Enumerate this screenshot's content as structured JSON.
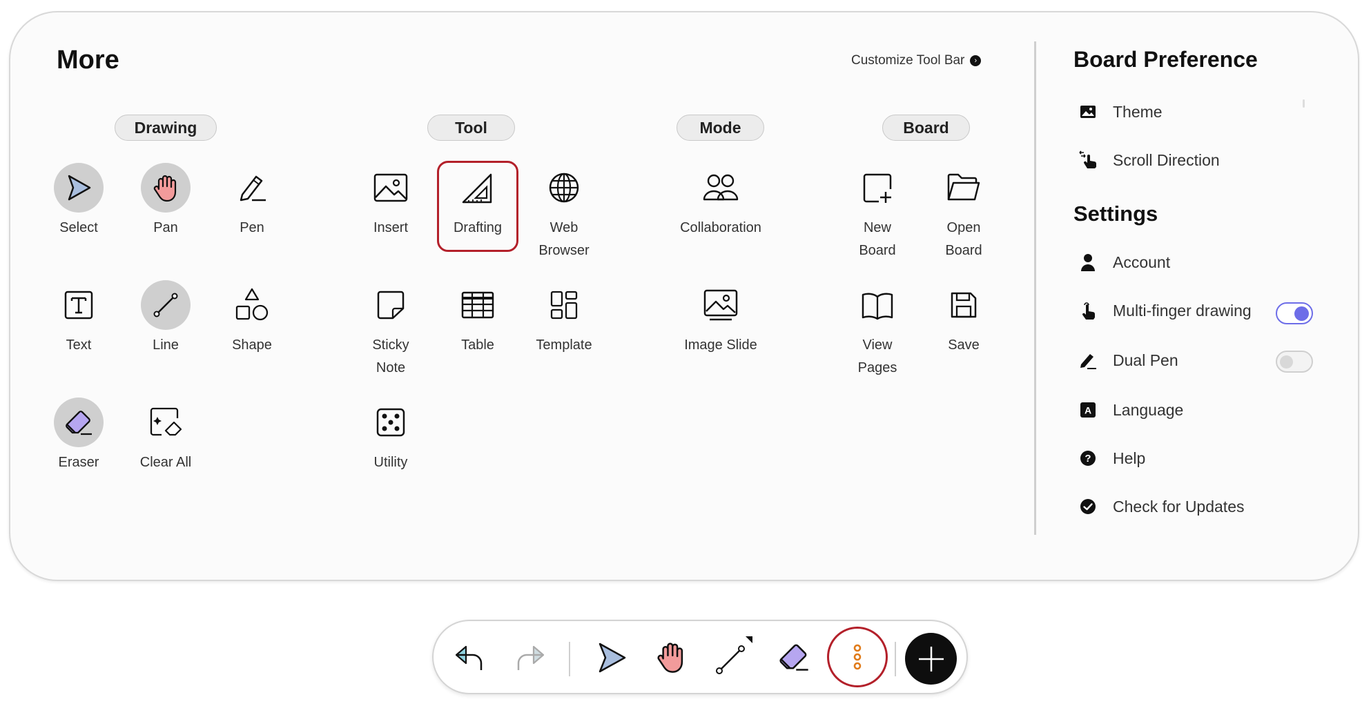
{
  "panel": {
    "title": "More",
    "customize_label": "Customize Tool Bar",
    "categories": {
      "drawing": "Drawing",
      "tool": "Tool",
      "mode": "Mode",
      "board": "Board"
    },
    "drawing_tools": [
      {
        "label": "Select",
        "icon": "select-arrow-icon",
        "selected": true
      },
      {
        "label": "Pan",
        "icon": "hand-icon",
        "selected": true
      },
      {
        "label": "Pen",
        "icon": "pen-icon",
        "selected": false
      },
      {
        "label": "Text",
        "icon": "text-icon",
        "selected": false
      },
      {
        "label": "Line",
        "icon": "line-icon",
        "selected": true
      },
      {
        "label": "Shape",
        "icon": "shape-icon",
        "selected": false
      },
      {
        "label": "Eraser",
        "icon": "eraser-icon",
        "selected": true
      },
      {
        "label": "Clear All",
        "icon": "clear-all-icon",
        "selected": false
      }
    ],
    "tool_tools": [
      {
        "label": "Insert",
        "icon": "image-icon"
      },
      {
        "label": "Drafting",
        "icon": "set-square-icon",
        "highlighted": true
      },
      {
        "label": "Web\nBrowser",
        "icon": "globe-icon"
      },
      {
        "label": "Sticky\nNote",
        "icon": "sticky-note-icon"
      },
      {
        "label": "Table",
        "icon": "table-icon"
      },
      {
        "label": "Template",
        "icon": "template-icon"
      },
      {
        "label": "Utility",
        "icon": "dice-icon"
      }
    ],
    "mode_tools": [
      {
        "label": "Collaboration",
        "icon": "people-icon"
      },
      {
        "label": "Image Slide",
        "icon": "image-slide-icon"
      }
    ],
    "board_tools": [
      {
        "label": "New\nBoard",
        "icon": "new-board-icon"
      },
      {
        "label": "Open\nBoard",
        "icon": "folder-icon"
      },
      {
        "label": "View\nPages",
        "icon": "book-icon"
      },
      {
        "label": "Save",
        "icon": "floppy-icon"
      }
    ]
  },
  "preferences": {
    "board_title": "Board Preference",
    "board_items": [
      {
        "label": "Theme",
        "icon": "image-icon"
      },
      {
        "label": "Scroll Direction",
        "icon": "scroll-hand-icon"
      }
    ],
    "settings_title": "Settings",
    "settings_items": [
      {
        "label": "Account",
        "icon": "person-icon"
      },
      {
        "label": "Multi-finger drawing",
        "icon": "finger-icon",
        "toggle": true
      },
      {
        "label": "Dual Pen",
        "icon": "dual-pen-icon",
        "toggle": false
      },
      {
        "label": "Language",
        "icon": "language-icon"
      },
      {
        "label": "Help",
        "icon": "help-icon"
      },
      {
        "label": "Check for Updates",
        "icon": "check-circle-icon"
      }
    ]
  },
  "toolbar": {
    "items": [
      "undo-icon",
      "redo-icon",
      "select-arrow-icon",
      "hand-icon",
      "line-icon",
      "eraser-icon",
      "more-vertical-icon",
      "exit-icon"
    ]
  },
  "colors": {
    "highlight": "#b3202a",
    "toggle_on": "#6d6de8",
    "select_fill": "#a9bede",
    "hand_fill": "#f29b9b",
    "eraser_fill": "#b6a6f0",
    "more_dots": "#e07b1a"
  }
}
